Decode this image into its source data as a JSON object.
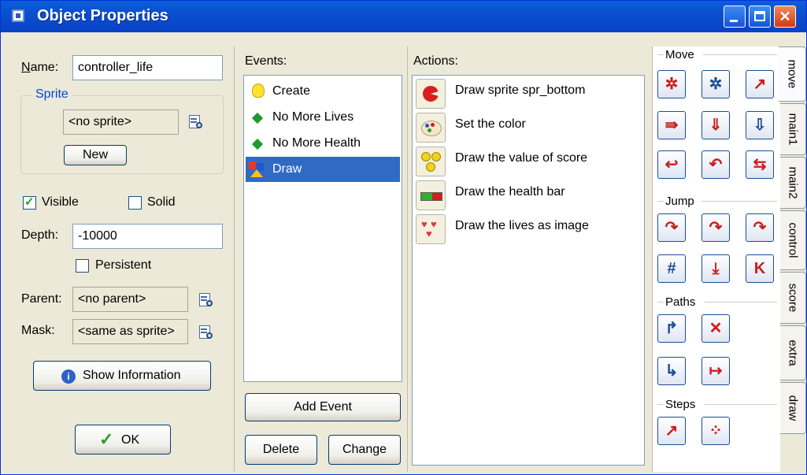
{
  "window": {
    "title": "Object Properties"
  },
  "titlebar": {
    "minimize_label": "",
    "maximize_label": "",
    "close_label": "✕"
  },
  "left": {
    "name_label": "Name:",
    "name_value": "controller_life",
    "sprite_group_title": "Sprite",
    "sprite_value": "<no sprite>",
    "new_button": "New",
    "visible_label": "Visible",
    "visible_checked": true,
    "solid_label": "Solid",
    "solid_checked": false,
    "depth_label": "Depth:",
    "depth_value": "-10000",
    "persistent_label": "Persistent",
    "persistent_checked": false,
    "parent_label": "Parent:",
    "parent_value": "<no parent>",
    "mask_label": "Mask:",
    "mask_value": "<same as sprite>",
    "show_info_button": "Show Information",
    "ok_button": "OK"
  },
  "events": {
    "header": "Events:",
    "items": [
      {
        "label": "Create",
        "icon": "lightbulb-icon"
      },
      {
        "label": "No More Lives",
        "icon": "green-diamond-icon"
      },
      {
        "label": "No More Health",
        "icon": "green-diamond-icon"
      },
      {
        "label": "Draw",
        "icon": "shapes-icon",
        "selected": true
      }
    ],
    "add_button": "Add Event",
    "delete_button": "Delete",
    "change_button": "Change"
  },
  "actions": {
    "header": "Actions:",
    "items": [
      {
        "label": "Draw sprite spr_bottom",
        "icon": "pacman-sprite-icon"
      },
      {
        "label": "Set the color",
        "icon": "palette-icon"
      },
      {
        "label": "Draw the value of score",
        "icon": "score-circles-icon"
      },
      {
        "label": "Draw the health bar",
        "icon": "health-bar-icon"
      },
      {
        "label": "Draw the lives as image",
        "icon": "hearts-icon"
      }
    ]
  },
  "palette": {
    "sections": [
      {
        "title": "Move"
      },
      {
        "title": "Jump"
      },
      {
        "title": "Paths"
      },
      {
        "title": "Steps"
      }
    ],
    "tabs": [
      "move",
      "main1",
      "main2",
      "control",
      "score",
      "extra",
      "draw"
    ],
    "active_tab": "move",
    "colors": {
      "red": "#cc1c1c",
      "blue": "#1d4c98"
    }
  }
}
